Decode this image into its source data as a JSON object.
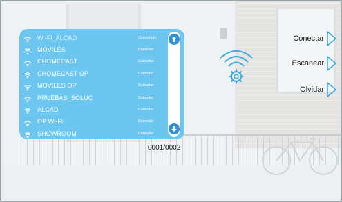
{
  "networks": [
    {
      "name": "Wi-Fi_ALCAD",
      "action": "Conectado",
      "active": true
    },
    {
      "name": "MOVILES",
      "action": "Conectar",
      "active": false
    },
    {
      "name": "CHOMECAST",
      "action": "Conectar",
      "active": false
    },
    {
      "name": "CHOMECAST OP",
      "action": "Conectar",
      "active": false
    },
    {
      "name": "MOVILES OP",
      "action": "Conectar",
      "active": false
    },
    {
      "name": "PRUEBAS_SOLUC",
      "action": "Conectar",
      "active": false
    },
    {
      "name": "ALCAD",
      "action": "Conectar",
      "active": false
    },
    {
      "name": "OP Wi-Fi",
      "action": "Conectar",
      "active": false
    },
    {
      "name": "SHOWROOM",
      "action": "Conectar",
      "active": false
    }
  ],
  "pagination": "0001/0002",
  "actions": {
    "connect": "Conectar",
    "scan": "Escanear",
    "forget": "Olvidar"
  },
  "icons": {
    "network": "wifi-icon",
    "settings": "wifi-settings-icon",
    "scroll_up": "arrow-up-icon",
    "scroll_down": "arrow-down-icon",
    "action": "triangle-right-icon"
  },
  "colors": {
    "panel": "#6cc6ef",
    "scroll_buttons": "#2f8fd9",
    "accent": "#3aa9e0",
    "text_dark": "#1a1a1a"
  }
}
